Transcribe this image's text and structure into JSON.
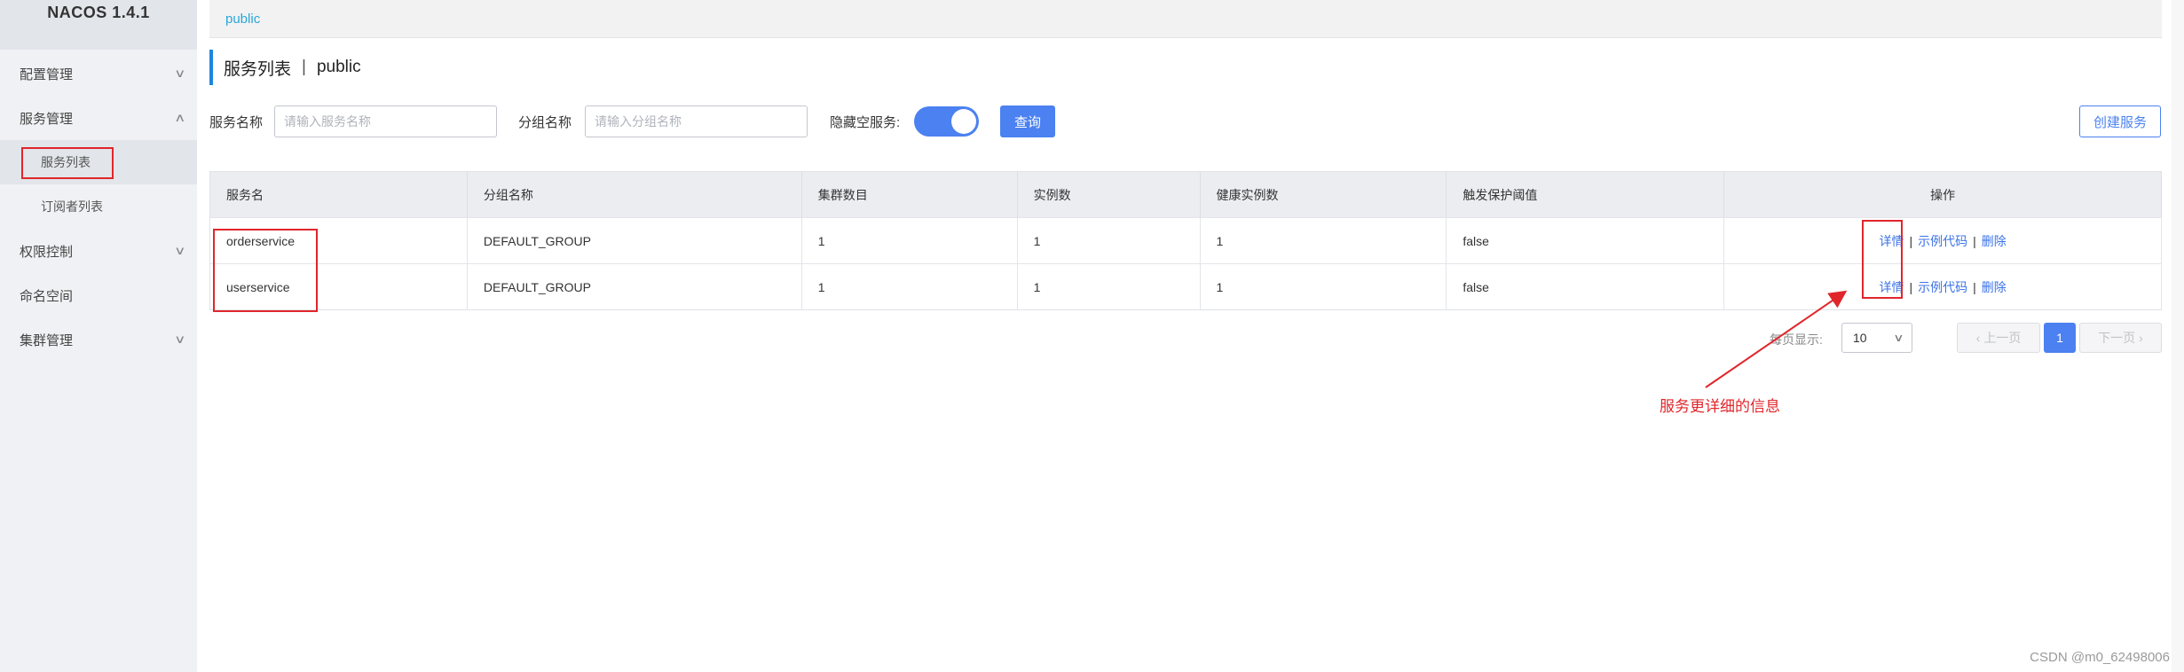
{
  "sidebar": {
    "brand": "NACOS 1.4.1",
    "items": [
      {
        "label": "配置管理",
        "chevron": "chevron-down-icon"
      },
      {
        "label": "服务管理",
        "chevron": "chevron-up-icon"
      },
      {
        "label": "权限控制",
        "chevron": "chevron-down-icon"
      },
      {
        "label": "命名空间"
      },
      {
        "label": "集群管理",
        "chevron": "chevron-down-icon"
      }
    ],
    "sub_items": [
      {
        "label": "服务列表",
        "active": true
      },
      {
        "label": "订阅者列表"
      }
    ]
  },
  "topbar": {
    "namespace_link": "public"
  },
  "page": {
    "title": "服务列表",
    "separator": "|",
    "namespace": "public"
  },
  "filters": {
    "service_name_label": "服务名称",
    "service_name_placeholder": "请输入服务名称",
    "group_name_label": "分组名称",
    "group_name_placeholder": "请输入分组名称",
    "hide_empty_label": "隐藏空服务:",
    "hide_empty_on": true,
    "search_button": "查询",
    "create_button": "创建服务"
  },
  "table": {
    "headers": [
      "服务名",
      "分组名称",
      "集群数目",
      "实例数",
      "健康实例数",
      "触发保护阈值",
      "操作"
    ],
    "rows": [
      {
        "name": "orderservice",
        "group": "DEFAULT_GROUP",
        "clusters": "1",
        "instances": "1",
        "healthy": "1",
        "threshold": "false"
      },
      {
        "name": "userservice",
        "group": "DEFAULT_GROUP",
        "clusters": "1",
        "instances": "1",
        "healthy": "1",
        "threshold": "false"
      }
    ],
    "ops": {
      "detail": "详情",
      "sample_code": "示例代码",
      "delete": "删除",
      "separator": "|"
    }
  },
  "pagination": {
    "page_size_label": "每页显示:",
    "page_size": "10",
    "prev": "上一页",
    "next": "下一页",
    "current_page": "1"
  },
  "annotation": {
    "text": "服务更详细的信息",
    "color": "#e0262b"
  },
  "watermark": "CSDN @m0_62498006",
  "colors": {
    "primary": "#4b81f0",
    "link": "#3b73e6",
    "annotation": "#e0262b",
    "sidebar_bg": "#eff1f4"
  }
}
